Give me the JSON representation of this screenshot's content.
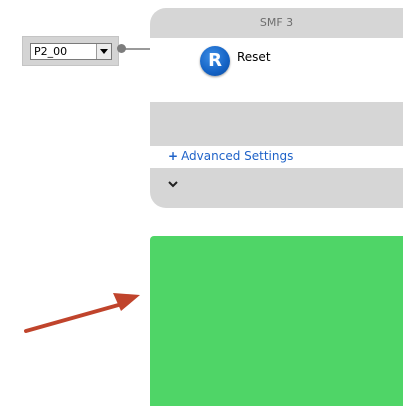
{
  "input_selector": {
    "value": "P2_00",
    "dropdown_icon": "triangle-down-icon"
  },
  "block": {
    "title": "SMF 3",
    "reset_icon_letter": "R",
    "reset_label": "Reset",
    "advanced_plus": "+",
    "advanced_label": "Advanced Settings",
    "collapse_glyph": "⌄"
  },
  "colors": {
    "block_bg": "#d6d6d6",
    "reset_icon": "#1462c4",
    "link": "#1e62c8",
    "green_block": "#4fd567",
    "arrow": "#c0442c"
  }
}
